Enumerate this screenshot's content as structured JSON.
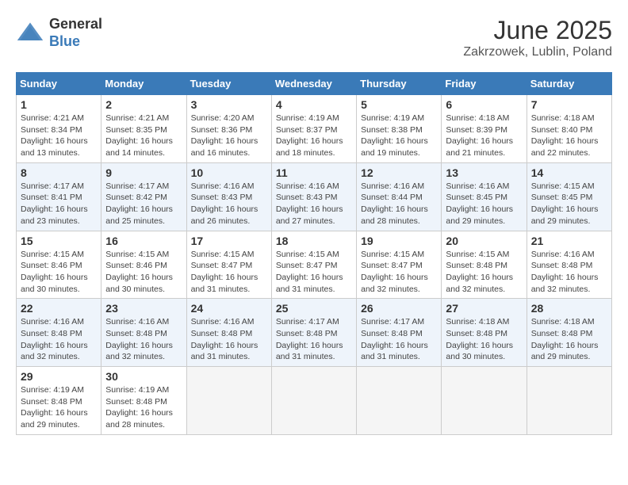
{
  "header": {
    "logo_general": "General",
    "logo_blue": "Blue",
    "month_title": "June 2025",
    "location": "Zakrzowek, Lublin, Poland"
  },
  "weekdays": [
    "Sunday",
    "Monday",
    "Tuesday",
    "Wednesday",
    "Thursday",
    "Friday",
    "Saturday"
  ],
  "weeks": [
    [
      {
        "day": "1",
        "info": "Sunrise: 4:21 AM\nSunset: 8:34 PM\nDaylight: 16 hours\nand 13 minutes."
      },
      {
        "day": "2",
        "info": "Sunrise: 4:21 AM\nSunset: 8:35 PM\nDaylight: 16 hours\nand 14 minutes."
      },
      {
        "day": "3",
        "info": "Sunrise: 4:20 AM\nSunset: 8:36 PM\nDaylight: 16 hours\nand 16 minutes."
      },
      {
        "day": "4",
        "info": "Sunrise: 4:19 AM\nSunset: 8:37 PM\nDaylight: 16 hours\nand 18 minutes."
      },
      {
        "day": "5",
        "info": "Sunrise: 4:19 AM\nSunset: 8:38 PM\nDaylight: 16 hours\nand 19 minutes."
      },
      {
        "day": "6",
        "info": "Sunrise: 4:18 AM\nSunset: 8:39 PM\nDaylight: 16 hours\nand 21 minutes."
      },
      {
        "day": "7",
        "info": "Sunrise: 4:18 AM\nSunset: 8:40 PM\nDaylight: 16 hours\nand 22 minutes."
      }
    ],
    [
      {
        "day": "8",
        "info": "Sunrise: 4:17 AM\nSunset: 8:41 PM\nDaylight: 16 hours\nand 23 minutes."
      },
      {
        "day": "9",
        "info": "Sunrise: 4:17 AM\nSunset: 8:42 PM\nDaylight: 16 hours\nand 25 minutes."
      },
      {
        "day": "10",
        "info": "Sunrise: 4:16 AM\nSunset: 8:43 PM\nDaylight: 16 hours\nand 26 minutes."
      },
      {
        "day": "11",
        "info": "Sunrise: 4:16 AM\nSunset: 8:43 PM\nDaylight: 16 hours\nand 27 minutes."
      },
      {
        "day": "12",
        "info": "Sunrise: 4:16 AM\nSunset: 8:44 PM\nDaylight: 16 hours\nand 28 minutes."
      },
      {
        "day": "13",
        "info": "Sunrise: 4:16 AM\nSunset: 8:45 PM\nDaylight: 16 hours\nand 29 minutes."
      },
      {
        "day": "14",
        "info": "Sunrise: 4:15 AM\nSunset: 8:45 PM\nDaylight: 16 hours\nand 29 minutes."
      }
    ],
    [
      {
        "day": "15",
        "info": "Sunrise: 4:15 AM\nSunset: 8:46 PM\nDaylight: 16 hours\nand 30 minutes."
      },
      {
        "day": "16",
        "info": "Sunrise: 4:15 AM\nSunset: 8:46 PM\nDaylight: 16 hours\nand 30 minutes."
      },
      {
        "day": "17",
        "info": "Sunrise: 4:15 AM\nSunset: 8:47 PM\nDaylight: 16 hours\nand 31 minutes."
      },
      {
        "day": "18",
        "info": "Sunrise: 4:15 AM\nSunset: 8:47 PM\nDaylight: 16 hours\nand 31 minutes."
      },
      {
        "day": "19",
        "info": "Sunrise: 4:15 AM\nSunset: 8:47 PM\nDaylight: 16 hours\nand 32 minutes."
      },
      {
        "day": "20",
        "info": "Sunrise: 4:15 AM\nSunset: 8:48 PM\nDaylight: 16 hours\nand 32 minutes."
      },
      {
        "day": "21",
        "info": "Sunrise: 4:16 AM\nSunset: 8:48 PM\nDaylight: 16 hours\nand 32 minutes."
      }
    ],
    [
      {
        "day": "22",
        "info": "Sunrise: 4:16 AM\nSunset: 8:48 PM\nDaylight: 16 hours\nand 32 minutes."
      },
      {
        "day": "23",
        "info": "Sunrise: 4:16 AM\nSunset: 8:48 PM\nDaylight: 16 hours\nand 32 minutes."
      },
      {
        "day": "24",
        "info": "Sunrise: 4:16 AM\nSunset: 8:48 PM\nDaylight: 16 hours\nand 31 minutes."
      },
      {
        "day": "25",
        "info": "Sunrise: 4:17 AM\nSunset: 8:48 PM\nDaylight: 16 hours\nand 31 minutes."
      },
      {
        "day": "26",
        "info": "Sunrise: 4:17 AM\nSunset: 8:48 PM\nDaylight: 16 hours\nand 31 minutes."
      },
      {
        "day": "27",
        "info": "Sunrise: 4:18 AM\nSunset: 8:48 PM\nDaylight: 16 hours\nand 30 minutes."
      },
      {
        "day": "28",
        "info": "Sunrise: 4:18 AM\nSunset: 8:48 PM\nDaylight: 16 hours\nand 29 minutes."
      }
    ],
    [
      {
        "day": "29",
        "info": "Sunrise: 4:19 AM\nSunset: 8:48 PM\nDaylight: 16 hours\nand 29 minutes."
      },
      {
        "day": "30",
        "info": "Sunrise: 4:19 AM\nSunset: 8:48 PM\nDaylight: 16 hours\nand 28 minutes."
      },
      null,
      null,
      null,
      null,
      null
    ]
  ]
}
